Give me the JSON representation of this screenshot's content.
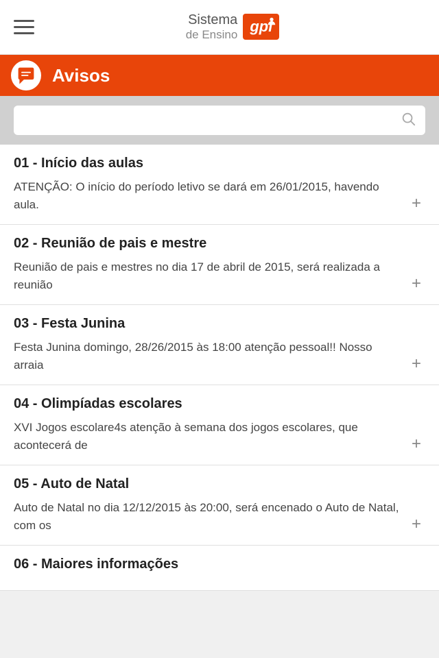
{
  "topbar": {
    "menu_label": "Menu",
    "logo_sistema": "Sistema",
    "logo_ensino": "de Ensino",
    "logo_gpi": "gpi"
  },
  "avisos_header": {
    "title": "Avisos",
    "icon": "chat-icon"
  },
  "search": {
    "placeholder": ""
  },
  "notices": [
    {
      "id": "01",
      "title": "01 - Início das aulas",
      "body": "ATENÇÃO: O início do período letivo se dará em 26/01/2015, havendo aula."
    },
    {
      "id": "02",
      "title": "02 - Reunião de pais e mestre",
      "body": "Reunião de pais e mestres no dia 17 de abril de 2015, será realizada a reunião"
    },
    {
      "id": "03",
      "title": "03 - Festa Junina",
      "body": "Festa Junina domingo, 28/26/2015 às 18:00 atenção pessoal!! Nosso arraia"
    },
    {
      "id": "04",
      "title": "04 -  Olimpíadas escolares",
      "body": "XVI Jogos escolare4s atenção à semana dos jogos escolares, que acontecerá de"
    },
    {
      "id": "05",
      "title": "05 - Auto de Natal",
      "body": "Auto de Natal no dia 12/12/2015 às 20:00, será encenado o Auto de Natal, com os"
    },
    {
      "id": "06",
      "title": "06 - Maiores informações",
      "body": ""
    }
  ],
  "plus_label": "+"
}
